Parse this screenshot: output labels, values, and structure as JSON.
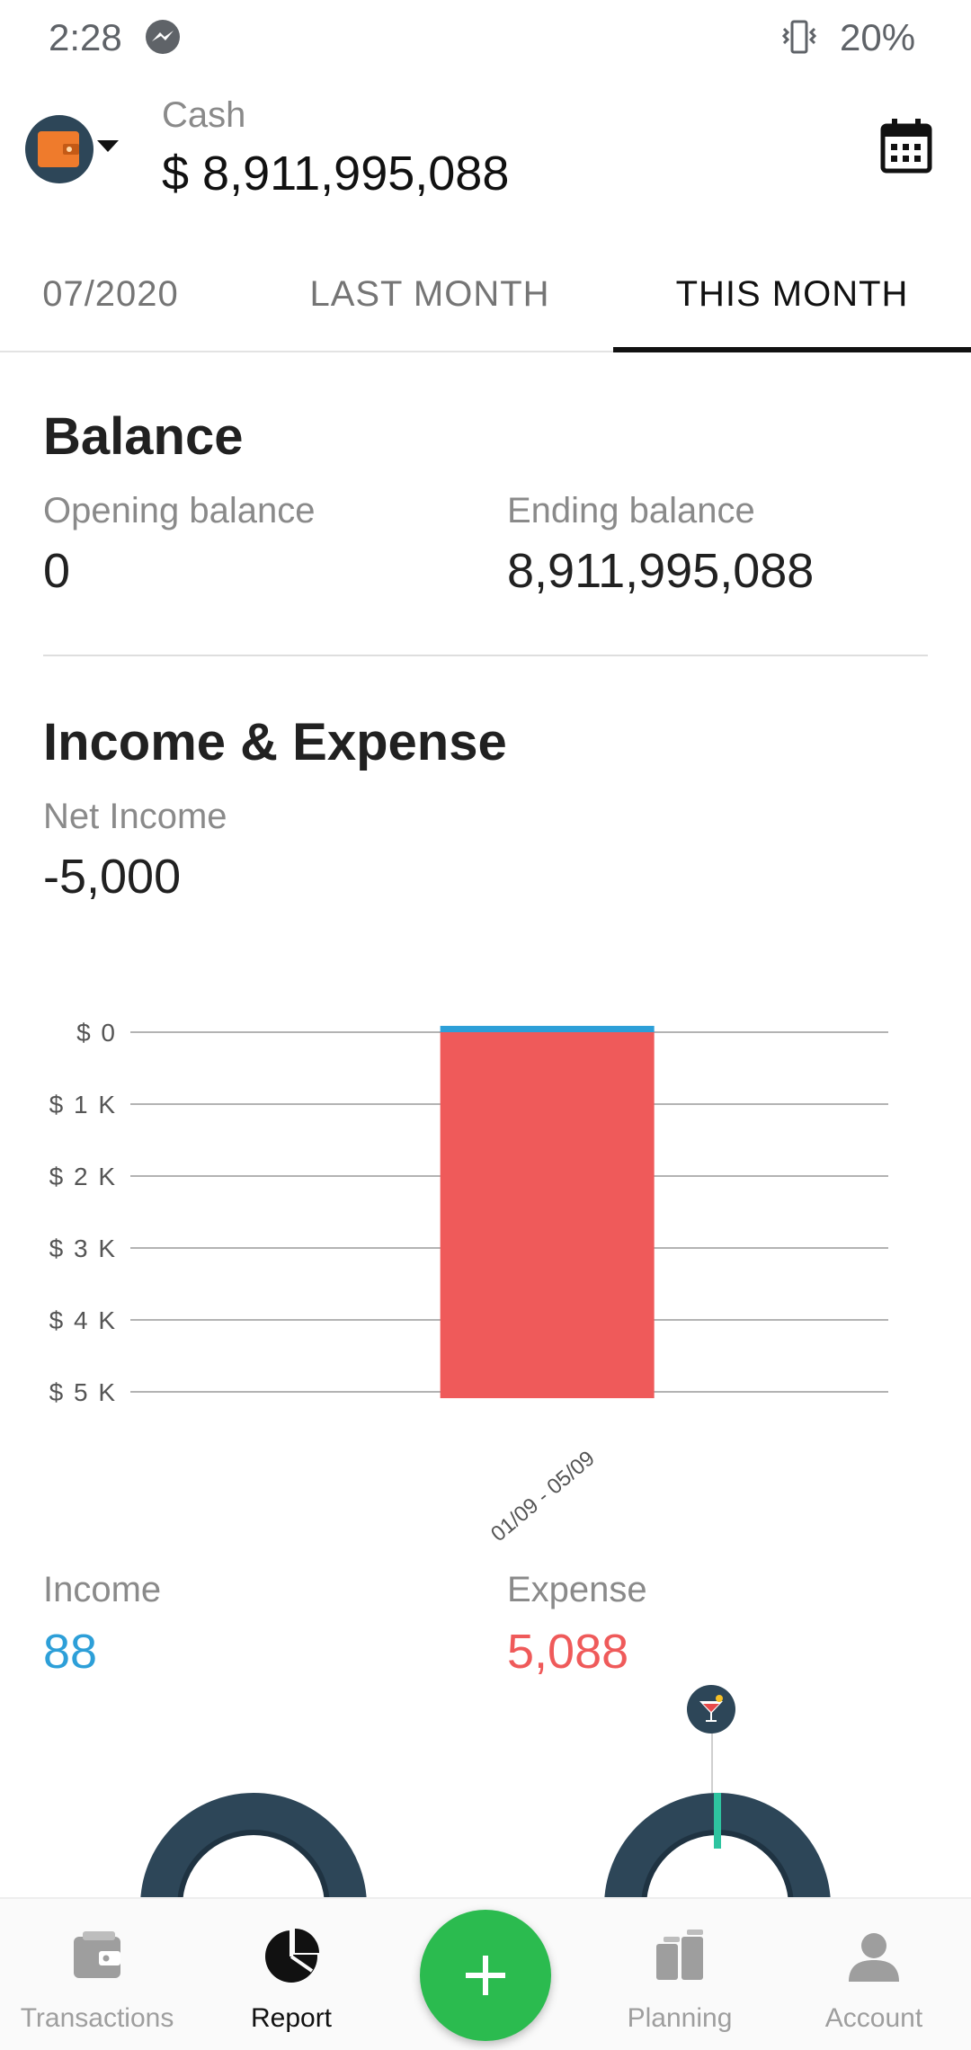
{
  "status_bar": {
    "time": "2:28",
    "battery": "20%",
    "icons": [
      "messenger-icon",
      "vibrate-icon"
    ]
  },
  "header": {
    "wallet_name": "Cash",
    "wallet_balance": "$ 8,911,995,088",
    "icons": [
      "wallet-icon",
      "chevron-down-icon",
      "calendar-icon"
    ]
  },
  "tabs": [
    {
      "label": "07/2020",
      "active": false
    },
    {
      "label": "LAST MONTH",
      "active": false
    },
    {
      "label": "THIS MONTH",
      "active": true
    }
  ],
  "balance": {
    "title": "Balance",
    "opening_label": "Opening balance",
    "opening_value": "0",
    "ending_label": "Ending balance",
    "ending_value": "8,911,995,088"
  },
  "income_expense": {
    "title": "Income & Expense",
    "net_label": "Net Income",
    "net_value": "-5,000",
    "income_label": "Income",
    "income_value": "88",
    "expense_label": "Expense",
    "expense_value": "5,088"
  },
  "colors": {
    "income": "#2d9fd8",
    "expense": "#ef5a5a",
    "fab": "#2bbb4f",
    "donut": "#2d4658"
  },
  "chart_data": {
    "type": "bar",
    "categories": [
      "01/09 - 05/09"
    ],
    "series": [
      {
        "name": "Income",
        "values": [
          88
        ],
        "color": "#2d9fd8"
      },
      {
        "name": "Expense",
        "values": [
          5088
        ],
        "color": "#ef5a5a"
      }
    ],
    "y_tick_labels": [
      "$ 0",
      "$ 1 K",
      "$ 2 K",
      "$ 3 K",
      "$ 4 K",
      "$ 5 K"
    ],
    "ylim": [
      0,
      5000
    ],
    "grid": true
  },
  "bottom_nav": {
    "items": [
      {
        "label": "Transactions",
        "icon": "wallet-icon",
        "active": false
      },
      {
        "label": "Report",
        "icon": "pie-chart-icon",
        "active": true
      },
      {
        "label": "Planning",
        "icon": "planning-icon",
        "active": false
      },
      {
        "label": "Account",
        "icon": "person-icon",
        "active": false
      }
    ],
    "fab_icon": "plus-icon"
  }
}
